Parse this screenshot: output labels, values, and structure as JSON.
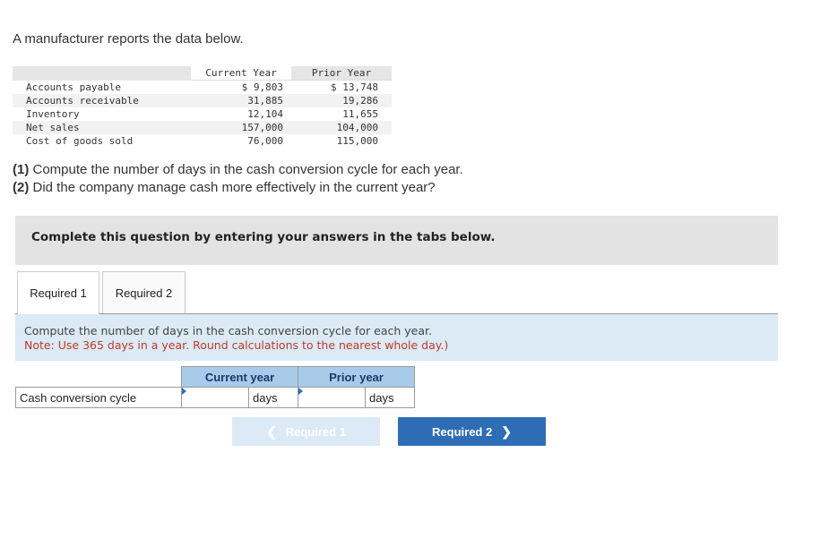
{
  "intro": "A manufacturer reports the data below.",
  "data_table": {
    "headers": [
      "Current Year",
      "Prior Year"
    ],
    "rows": [
      {
        "label": "Accounts payable",
        "current": "$ 9,803",
        "prior": "$ 13,748"
      },
      {
        "label": "Accounts receivable",
        "current": "31,885",
        "prior": "19,286"
      },
      {
        "label": "Inventory",
        "current": "12,104",
        "prior": "11,655"
      },
      {
        "label": "Net sales",
        "current": "157,000",
        "prior": "104,000"
      },
      {
        "label": "Cost of goods sold",
        "current": "76,000",
        "prior": "115,000"
      }
    ]
  },
  "questions": {
    "q1_num": "(1)",
    "q1_text": " Compute the number of days in the cash conversion cycle for each year.",
    "q2_num": "(2)",
    "q2_text": " Did the company manage cash more effectively in the current year?"
  },
  "banner": "Complete this question by entering your answers in the tabs below.",
  "tabs": [
    "Required 1",
    "Required 2"
  ],
  "instructions": {
    "line1": "Compute the number of days in the cash conversion cycle for each year.",
    "line2": "Note: Use 365 days in a year. Round calculations to the nearest whole day.)"
  },
  "answer_table": {
    "col_current": "Current year",
    "col_prior": "Prior year",
    "row_label": "Cash conversion cycle",
    "unit": "days",
    "current_value": "",
    "prior_value": ""
  },
  "nav": {
    "prev_label": "Required 1",
    "next_label": "Required 2"
  },
  "colors": {
    "accent": "#2e6db5",
    "instruction_note": "#c0392b",
    "header_fill": "#a8cbe9"
  }
}
